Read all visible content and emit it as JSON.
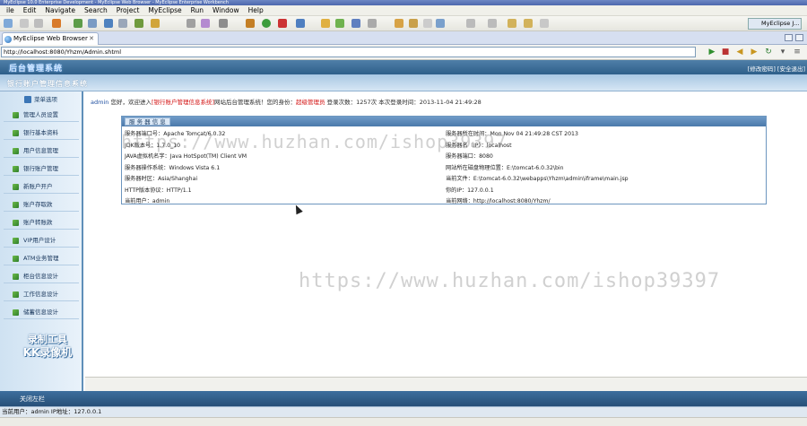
{
  "window": {
    "title": "MyEclipse 10.0 Enterprise Development - MyEclipse Web Browser - MyEclipse Enterprise Workbench"
  },
  "menu": [
    "ile",
    "Edit",
    "Navigate",
    "Search",
    "Project",
    "MyEclipse",
    "Run",
    "Window",
    "Help"
  ],
  "perspective": {
    "label": "MyEclipse J..."
  },
  "tab": {
    "label": "MyEclipse Web Browser",
    "close": "✕"
  },
  "browser": {
    "url": "http://localhost:8080/Yhzm/Admin.shtml"
  },
  "app": {
    "logo": "后台管理系统",
    "toplinks": "[修改密码] [安全退出]",
    "subtitle": "银行账户管理信息系统"
  },
  "sidebar": {
    "header": "菜单选项",
    "items": [
      {
        "label": "管理人员设置"
      },
      {
        "label": "银行基本资料"
      },
      {
        "label": "用户信息管理"
      },
      {
        "label": "银行账户管理"
      },
      {
        "label": "新账户开户"
      },
      {
        "label": "账户存取款"
      },
      {
        "label": "账户转账款"
      },
      {
        "label": "VIP用户设计"
      },
      {
        "label": "ATM业务管理"
      },
      {
        "label": "柜台信息设计"
      },
      {
        "label": "工作信息设计"
      },
      {
        "label": "储蓄信息设计"
      }
    ],
    "watermark_line1": "录制工具",
    "watermark_line2": "KK录像机"
  },
  "welcome": {
    "user": "admin",
    "text1": "您好，欢迎进入",
    "system_name": "[银行账户管理信息系统]",
    "text2": "网站后台管理系统！您的身份：",
    "role": "超级管理员",
    "text3": " 登录次数：1257次 本次登录时间：2013-11-04 21:49:28"
  },
  "server_info": {
    "title": "服 务 器 信 息",
    "left": [
      "服务器端口号：Apache Tomcat/6.0.32",
      "JDK版本号：1.7.0_10",
      "JAVA虚拟机名字：Java HotSpot(TM) Client VM",
      "服务器操作系统：Windows Vista 6.1",
      "服务器时区：Asia/Shanghai",
      "HTTP版本协议：HTTP/1.1",
      "当前用户：admin"
    ],
    "right": [
      "服务器所在时间：Mon Nov 04 21:49:28 CST 2013",
      "服务器名（IP）：localhost",
      "服务器端口：8080",
      "网站所在磁盘物理位置：E:\\tomcat-6.0.32\\bin",
      "当前文件：E:\\tomcat-6.0.32\\webapps\\Yhzm\\admin\\iframe\\main.jsp",
      "你的IP：127.0.0.1",
      "当前网络：http://localhost:8080/Yhzm/"
    ]
  },
  "watermark": {
    "url1": "https://www.huzhan.com/ishop39397",
    "url2": "https://www.huzhan.com/ishop39397"
  },
  "footer": {
    "close_nav": "关闭左栏",
    "status": "当前用户：admin  IP地址：127.0.0.1"
  }
}
